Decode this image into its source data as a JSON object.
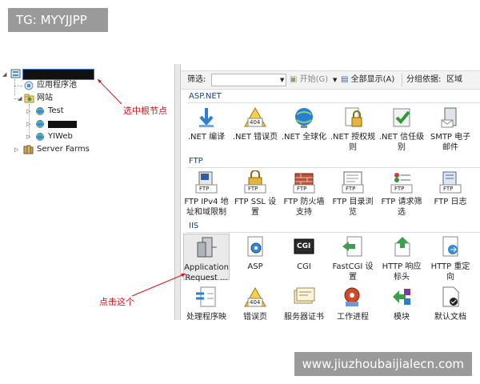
{
  "watermark_top": "TG: MYYJJPP",
  "watermark_bottom": "www.jiuzhoubaijialecn.com",
  "tree": {
    "app_pools": "应用程序池",
    "sites": "网站",
    "site_test": "Test",
    "site_yiweb": "YIWeb",
    "server_farms": "Server Farms"
  },
  "toolbar": {
    "filter_label": "筛选:",
    "start": "开始(G)",
    "show_all": "全部显示(A)",
    "group_by": "分组依据:",
    "group_value": "区域"
  },
  "groups": {
    "aspnet": "ASP.NET",
    "ftp": "FTP",
    "iis": "IIS"
  },
  "aspnet_tiles": [
    ".NET 编译",
    ".NET 错误页",
    ".NET 全球化",
    ".NET 授权规则",
    ".NET 信任级别",
    "SMTP 电子邮件"
  ],
  "ftp_tiles": [
    "FTP IPv4 地址和域限制",
    "FTP SSL 设置",
    "FTP 防火墙支持",
    "FTP 目录浏览",
    "FTP 请求筛选",
    "FTP 日志"
  ],
  "iis_tiles": [
    "Application Request ...",
    "ASP",
    "CGI",
    "FastCGI 设置",
    "HTTP 响应标头",
    "HTTP 重定向"
  ],
  "iis_tiles2": [
    "处理程序映",
    "错误页",
    "服务器证书",
    "工作进程",
    "模块",
    "默认文档"
  ],
  "icon_text": {
    "err404": "404",
    "ftp": "FTP",
    "cgi": "CGI"
  },
  "annotations": {
    "select_root": "选中根节点",
    "click_this": "点击这个"
  },
  "colors": {
    "annotation": "#d6121b",
    "group_header": "#1d3f7a"
  }
}
